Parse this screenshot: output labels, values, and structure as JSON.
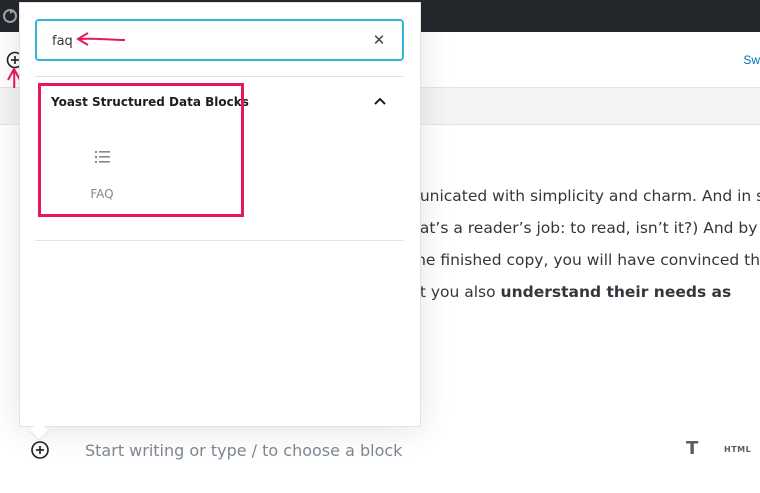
{
  "header": {
    "switch_label": "Sw"
  },
  "inserter": {
    "search_value": "faq",
    "panel_title": "Yoast Structured Data Blocks",
    "blocks": [
      {
        "label": "FAQ",
        "icon": "list-icon"
      }
    ]
  },
  "content": {
    "lines": [
      "nunicated with simplicity and charm. And in su",
      "hat’s a reader’s job: to read, isn’t it?) And by th",
      "the finished copy, you will have convinced the"
    ],
    "line4_prefix": "ut you also ",
    "line4_bold": "understand their needs as"
  },
  "appender": {
    "placeholder": "Start writing or type / to choose a block",
    "format_label": "T",
    "html_label": "HTML"
  },
  "colors": {
    "admin_bar": "#23282d",
    "focus_border": "#33b3db",
    "annotation": "#e8175d",
    "link": "#0073aa"
  }
}
